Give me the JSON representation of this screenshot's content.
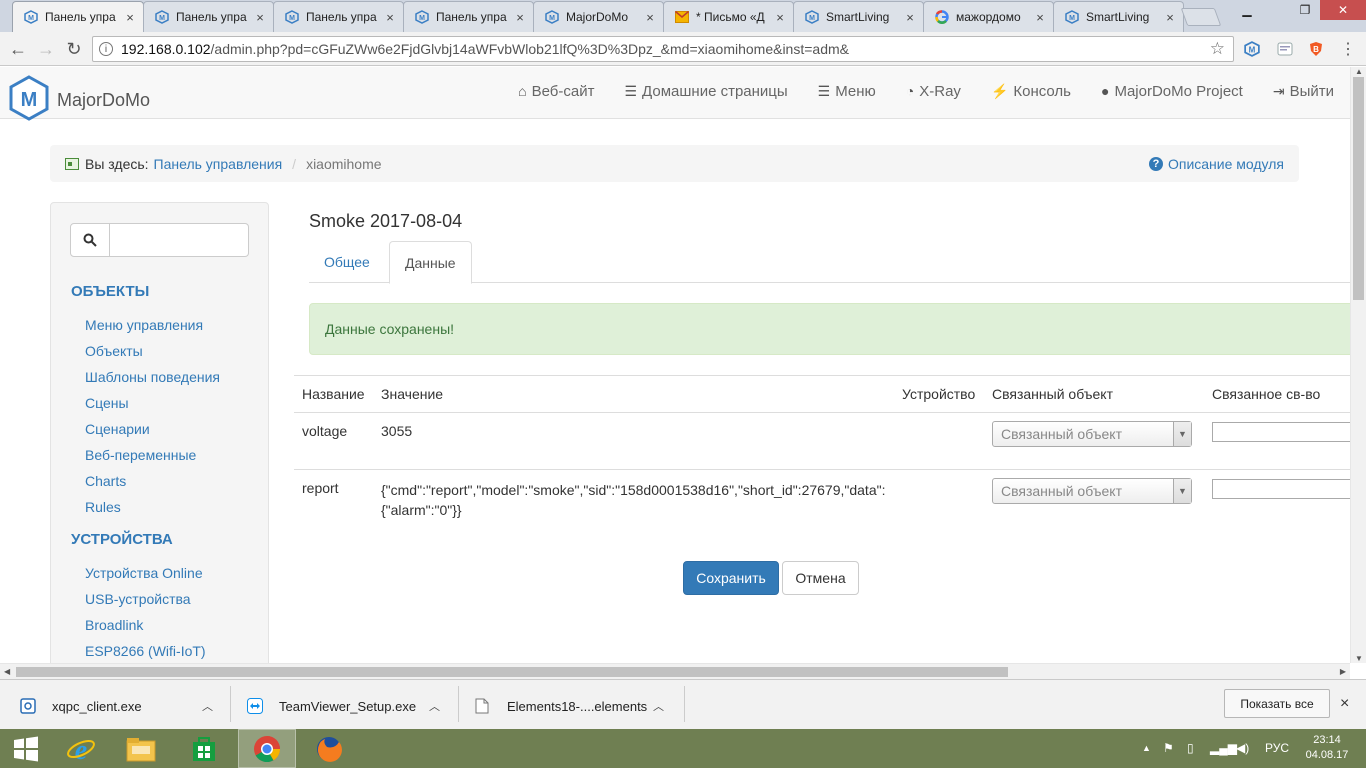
{
  "browser": {
    "tabs": [
      {
        "title": "Панель упра",
        "favicon": "majordomo-icon",
        "active": true
      },
      {
        "title": "Панель упра",
        "favicon": "majordomo-icon"
      },
      {
        "title": "Панель упра",
        "favicon": "majordomo-icon"
      },
      {
        "title": "Панель упра",
        "favicon": "majordomo-icon"
      },
      {
        "title": "MajorDoMo",
        "favicon": "majordomo-icon"
      },
      {
        "title": "* Письмо «Д",
        "favicon": "mail-icon"
      },
      {
        "title": "SmartLiving",
        "favicon": "majordomo-icon"
      },
      {
        "title": "мажордомо",
        "favicon": "google-icon"
      },
      {
        "title": "SmartLiving",
        "favicon": "majordomo-icon"
      }
    ],
    "tab_close": "×",
    "url_host": "192.168.0.102",
    "url_path": "/admin.php?pd=cGFuZWw6e2FjdGlvbj14aWFvbWlob21lfQ%3D%3Dpz_&md=xiaomihome&inst=adm&"
  },
  "header": {
    "brand": "MajorDoMo",
    "nav": [
      {
        "label": "Веб-сайт",
        "icon": "home-icon"
      },
      {
        "label": "Домашние страницы",
        "icon": "list-icon"
      },
      {
        "label": "Меню",
        "icon": "list-icon"
      },
      {
        "label": "X-Ray",
        "icon": "dashboard-icon"
      },
      {
        "label": "Консоль",
        "icon": "flash-icon"
      },
      {
        "label": "MajorDoMo Project",
        "icon": "globe-icon"
      },
      {
        "label": "Выйти",
        "icon": "logout-icon"
      }
    ]
  },
  "breadcrumb": {
    "prefix": "Вы здесь:",
    "home": "Панель управления",
    "current": "xiaomihome",
    "help": "Описание модуля"
  },
  "sidebar": {
    "search_placeholder": "",
    "sections": [
      {
        "title": "ОБЪЕКТЫ",
        "items": [
          "Меню управления",
          "Объекты",
          "Шаблоны поведения",
          "Сцены",
          "Сценарии",
          "Веб-переменные",
          "Charts",
          "Rules"
        ]
      },
      {
        "title": "УСТРОЙСТВА",
        "items": [
          "Устройства Online",
          "USB-устройства",
          "Broadlink",
          "ESP8266 (Wifi-IoT)"
        ]
      }
    ]
  },
  "main": {
    "title": "Smoke 2017-08-04",
    "tabs": [
      {
        "label": "Общее"
      },
      {
        "label": "Данные",
        "active": true
      }
    ],
    "alert": "Данные сохранены!",
    "table": {
      "headers": [
        "Название",
        "Значение",
        "Устройство",
        "Связанный объект",
        "Связанное св-во"
      ],
      "rows": [
        {
          "name": "voltage",
          "value": "3055",
          "value2": "",
          "linked_object": "Связанный объект"
        },
        {
          "name": "report",
          "value": "{\"cmd\":\"report\",\"model\":\"smoke\",\"sid\":\"158d0001538d16\",\"short_id\":27679,\"data\":",
          "value2": "{\"alarm\":\"0\"}}",
          "linked_object": "Связанный объект"
        }
      ]
    },
    "save": "Сохранить",
    "cancel": "Отмена"
  },
  "downloads": {
    "items": [
      {
        "name": "xqpc_client.exe"
      },
      {
        "name": "TeamViewer_Setup.exe"
      },
      {
        "name": "Elements18-....elements"
      }
    ],
    "show_all": "Показать все",
    "close": "×"
  },
  "taskbar": {
    "lang": "РУС",
    "time": "23:14",
    "date": "04.08.17"
  },
  "colors": {
    "link": "#337ab7",
    "success_bg": "#dff0d8",
    "success_text": "#3c763d",
    "primary": "#337ab7",
    "taskbar": "#6f7f52"
  }
}
